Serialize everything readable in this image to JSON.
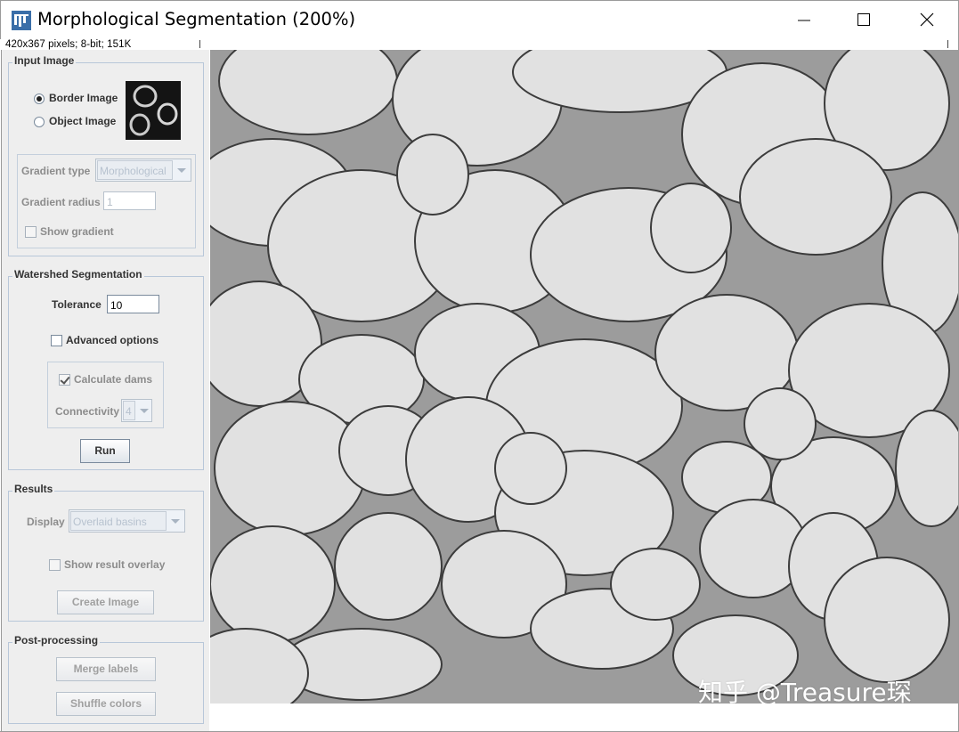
{
  "window": {
    "title": "Morphological Segmentation (200%)",
    "info": "420x367 pixels; 8-bit; 151K",
    "icons": {
      "app": "imagej-icon",
      "minimize": "minimize-icon",
      "maximize": "maximize-icon",
      "close": "close-icon"
    }
  },
  "input_image": {
    "legend": "Input Image",
    "border_image_label": "Border Image",
    "object_image_label": "Object Image",
    "selected": "Border Image",
    "gradient_type_label": "Gradient type",
    "gradient_type_value": "Morphological",
    "gradient_radius_label": "Gradient radius",
    "gradient_radius_value": "1",
    "show_gradient_label": "Show gradient",
    "show_gradient_checked": false
  },
  "watershed": {
    "legend": "Watershed Segmentation",
    "tolerance_label": "Tolerance",
    "tolerance_value": "10",
    "advanced_label": "Advanced options",
    "advanced_checked": false,
    "calc_dams_label": "Calculate dams",
    "calc_dams_checked": true,
    "connectivity_label": "Connectivity",
    "connectivity_value": "4",
    "run_label": "Run"
  },
  "results": {
    "legend": "Results",
    "display_label": "Display",
    "display_value": "Overlaid basins",
    "overlay_label": "Show result overlay",
    "overlay_checked": false,
    "create_label": "Create Image"
  },
  "post": {
    "legend": "Post-processing",
    "merge_label": "Merge labels",
    "shuffle_label": "Shuffle colors"
  },
  "canvas": {
    "watermark": "知乎 @Treasure琛"
  }
}
